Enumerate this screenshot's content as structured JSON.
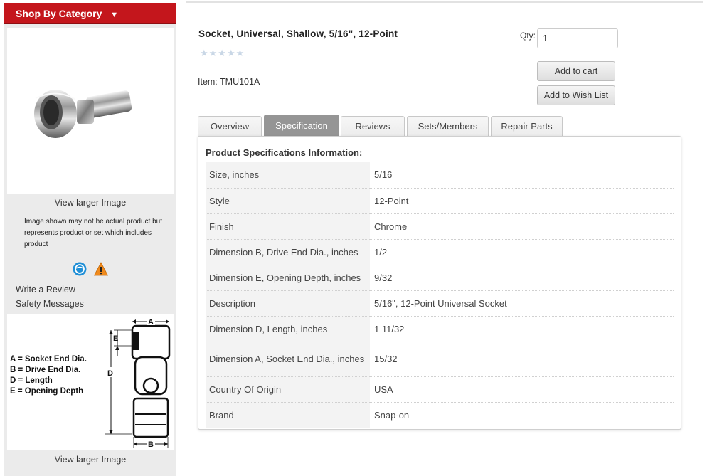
{
  "sidebar": {
    "category_button": "Shop By Category",
    "category_arrow": "▼",
    "view_larger_1": "View larger Image",
    "disclaimer": "Image shown may not be actual product but represents product or set which includes product",
    "write_review": "Write a Review",
    "safety_messages": "Safety Messages",
    "view_larger_2": "View larger Image",
    "diagram_legend": [
      "A = Socket End Dia.",
      "B = Drive End Dia.",
      "D = Length",
      "E = Opening Depth"
    ],
    "diagram_dims": {
      "a": "A",
      "b": "B",
      "d": "D",
      "e": "E"
    },
    "colors": {
      "category_bg": "#c4161c",
      "sidebar_bg": "#ebebeb"
    }
  },
  "product": {
    "title": "Socket, Universal, Shallow, 5/16\", 12-Point",
    "rating_stars": "★★★★★",
    "item": "Item: TMU101A",
    "qty_label": "Qty:",
    "qty_value": "1",
    "add_to_cart": "Add to cart",
    "add_to_wishlist": "Add to Wish List"
  },
  "tabs": [
    {
      "label": "Overview",
      "active": false
    },
    {
      "label": "Specification",
      "active": true
    },
    {
      "label": "Reviews",
      "active": false
    },
    {
      "label": "Sets/Members",
      "active": false
    },
    {
      "label": "Repair Parts",
      "active": false
    }
  ],
  "spec": {
    "heading": "Product Specifications Information:",
    "rows": [
      {
        "key": "Size, inches",
        "value": "5/16"
      },
      {
        "key": "Style",
        "value": "12-Point"
      },
      {
        "key": "Finish",
        "value": "Chrome"
      },
      {
        "key": "Dimension B, Drive End Dia., inches",
        "value": "1/2"
      },
      {
        "key": "Dimension E, Opening Depth, inches",
        "value": "9/32"
      },
      {
        "key": "Description",
        "value": "5/16\", 12-Point Universal Socket"
      },
      {
        "key": "Dimension D, Length, inches",
        "value": "1 11/32"
      },
      {
        "key": "Dimension A, Socket End Dia., inches",
        "value": "15/32"
      },
      {
        "key": "Country Of Origin",
        "value": "USA"
      },
      {
        "key": "Brand",
        "value": "Snap-on"
      }
    ]
  }
}
